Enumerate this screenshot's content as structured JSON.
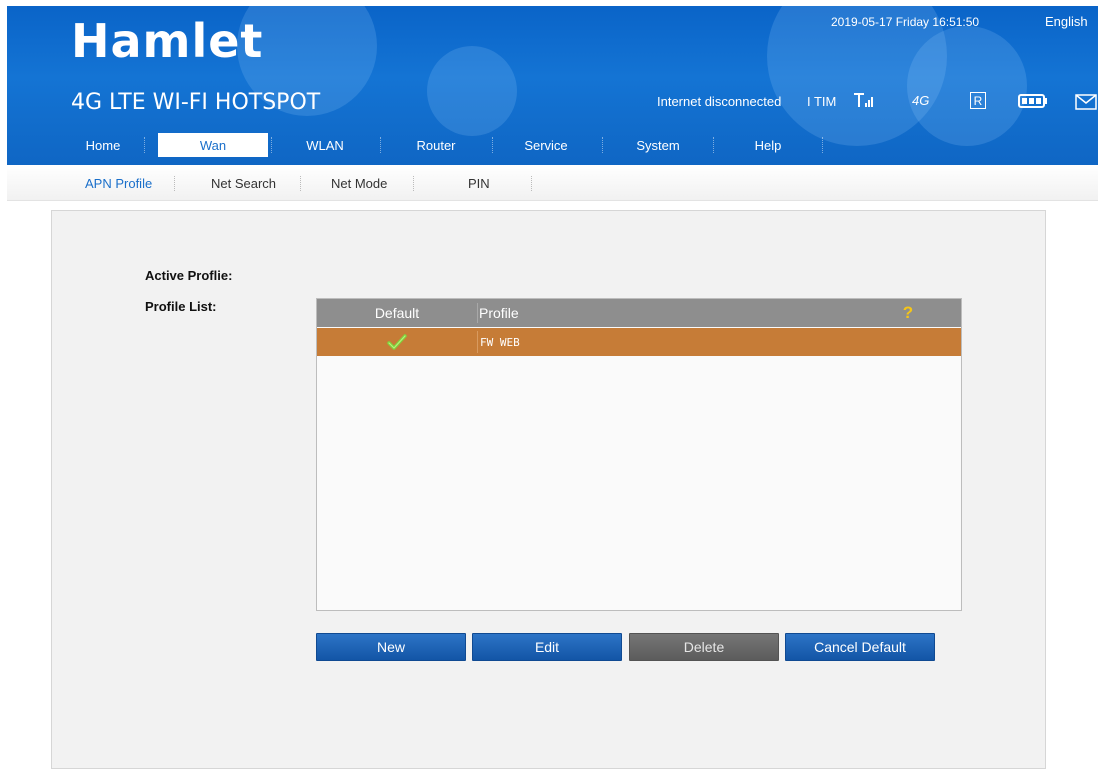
{
  "header": {
    "logo": "Hamlet",
    "tagline": "4G LTE WI-FI HOTSPOT",
    "datetime": "2019-05-17 Friday 16:51:50",
    "language": "English",
    "connection_status": "Internet disconnected",
    "carrier": "I TIM",
    "network_type": "4G",
    "roaming": "R",
    "icons": [
      "signal-icon",
      "4g-icon",
      "roaming-icon",
      "battery-icon",
      "message-icon"
    ]
  },
  "nav": {
    "items": [
      "Home",
      "Wan",
      "WLAN",
      "Router",
      "Service",
      "System",
      "Help"
    ],
    "active": "Wan"
  },
  "subnav": {
    "items": [
      "APN Profile",
      "Net Search",
      "Net Mode",
      "PIN"
    ],
    "active": "APN Profile"
  },
  "form": {
    "active_profile_label": "Active Proflie:",
    "profile_list_label": "Profile List:"
  },
  "grid": {
    "columns": [
      "Default",
      "Profile"
    ],
    "rows": [
      {
        "default": true,
        "profile": "FW WEB",
        "selected": true
      }
    ]
  },
  "buttons": {
    "new": "New",
    "edit": "Edit",
    "delete": "Delete",
    "cancel_default": "Cancel Default"
  },
  "colors": {
    "header_blue": "#1474d4",
    "accent_blue": "#1a6fca",
    "selected_row": "#c67c37",
    "button_blue": "#1355a6",
    "button_disabled": "#5c5c5c",
    "help_icon": "#f5c518"
  }
}
